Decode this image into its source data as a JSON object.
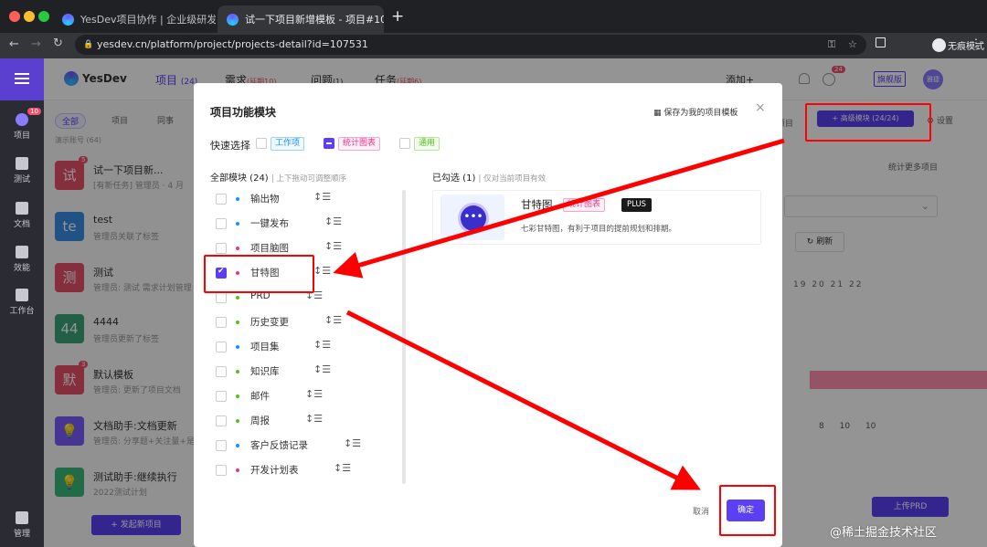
{
  "browser": {
    "tabs": [
      {
        "title": "YesDev项目协作 | 企业级研发协"
      },
      {
        "title": "试一下项目新增模板 - 项目#107"
      }
    ],
    "new_tab": "+",
    "url": "yesdev.cn/platform/project/projects-detail?id=107531",
    "incognito_label": "无痕模式"
  },
  "app": {
    "logo": "YesDev",
    "nav": [
      {
        "label": "项目",
        "badge": "(24)"
      },
      {
        "label": "需求",
        "badge": "(延期10)"
      },
      {
        "label": "问题",
        "badge": "(1)"
      },
      {
        "label": "任务",
        "badge": "(延期6)"
      }
    ],
    "add_label": "添加+",
    "notif_badge": "24",
    "edition": "旗舰版",
    "avatar": "雅捷",
    "rail": [
      {
        "label": "项目",
        "badge": "10"
      },
      {
        "label": "测试"
      },
      {
        "label": "文档"
      },
      {
        "label": "效能"
      },
      {
        "label": "工作台"
      },
      {
        "label": "管理"
      }
    ],
    "filters": [
      "全部",
      "项目",
      "同事"
    ],
    "demo_count": "演示账号 (64)",
    "projects": [
      {
        "tile": "试",
        "title": "试一下项目新...",
        "sub": "[有新任务] 管理员 · 4 月",
        "badge": "5",
        "color": "#e8506a"
      },
      {
        "tile": "te",
        "title": "test",
        "sub": "管理员关联了标签",
        "badge": "",
        "color": "#3a8ee6"
      },
      {
        "tile": "测",
        "title": "测试",
        "sub": "管理员: 测试 需求计划管理",
        "badge": "",
        "color": "#e8506a"
      },
      {
        "tile": "44",
        "title": "4444",
        "sub": "管理员更新了标签",
        "badge": "",
        "color": "#3aa57a"
      },
      {
        "tile": "默",
        "title": "默认模板",
        "sub": "管理员: 更新了项目文档",
        "badge": "3",
        "color": "#e8506a"
      },
      {
        "tile": "💡",
        "title": "文档助手:文档更新",
        "sub": "管理员: 分享题+关注量+是",
        "badge": "",
        "color": "#7a5cff"
      },
      {
        "tile": "💡",
        "title": "测试助手:继续执行",
        "sub": "2022测试计划",
        "badge": "",
        "color": "#3ab87a"
      }
    ],
    "new_project": "+ 发起新项目",
    "right": {
      "advanced_module": "+ 高级模块 (24/24)",
      "settings": "设置",
      "project_tab": "项目",
      "stats_more": "统计更多项目",
      "refresh": "刷新",
      "upload_prd": "上传PRD",
      "dates": [
        "19",
        "20",
        "21",
        "22"
      ],
      "nums": [
        "8",
        "10",
        "10"
      ]
    }
  },
  "modal": {
    "title": "项目功能模块",
    "save_template": "保存为我的项目模板",
    "quick_select": "快速选择",
    "quick_tags": [
      {
        "label": "工作项",
        "color": "#1890ff",
        "checked": false
      },
      {
        "label": "统计图表",
        "color": "#e8368c",
        "checked": true
      },
      {
        "label": "通用",
        "color": "#52c41a",
        "checked": false
      }
    ],
    "all_modules_label": "全部模块 (24)",
    "drag_hint": "上下拖动可调整顺序",
    "selected_label": "已勾选 (1)",
    "selected_hint": "仅对当前项目有效",
    "modules": [
      {
        "label": "输出物",
        "color": "#1890ff",
        "checked": false
      },
      {
        "label": "一键发布",
        "color": "#1890ff",
        "checked": false
      },
      {
        "label": "项目脑图",
        "color": "#e8368c",
        "checked": false
      },
      {
        "label": "甘特图",
        "color": "#e8368c",
        "checked": true
      },
      {
        "label": "PRD",
        "color": "#52c41a",
        "checked": false
      },
      {
        "label": "历史变更",
        "color": "#52c41a",
        "checked": false
      },
      {
        "label": "项目集",
        "color": "#1890ff",
        "checked": false
      },
      {
        "label": "知识库",
        "color": "#52c41a",
        "checked": false
      },
      {
        "label": "邮件",
        "color": "#52c41a",
        "checked": false
      },
      {
        "label": "周报",
        "color": "#52c41a",
        "checked": false
      },
      {
        "label": "客户反馈记录",
        "color": "#1890ff",
        "checked": false
      },
      {
        "label": "开发计划表",
        "color": "#e8368c",
        "checked": false
      }
    ],
    "card": {
      "name": "甘特图",
      "tag": "统计图表",
      "plus": "PLUS",
      "desc": "七彩甘特图，有利于项目的提前规划和排期。"
    },
    "cancel": "取消",
    "confirm": "确定"
  },
  "watermark": "@稀土掘金技术社区",
  "colors": {
    "accent": "#5b3ff5",
    "annotation": "#ff0000"
  }
}
